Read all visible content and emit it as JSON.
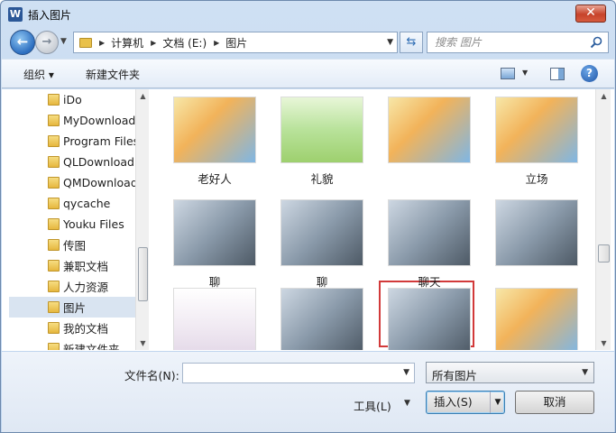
{
  "window": {
    "title": "插入图片",
    "app_icon": "W",
    "close_glyph": "✕"
  },
  "nav": {
    "back_glyph": "←",
    "forward_glyph": "→",
    "breadcrumbs": [
      "计算机",
      "文档 (E:)",
      "图片"
    ],
    "search_placeholder": "搜索 图片"
  },
  "toolbar": {
    "organize_label": "组织 ▾",
    "new_folder_label": "新建文件夹",
    "help_glyph": "?"
  },
  "sidebar": {
    "items": [
      {
        "label": "iDo",
        "selected": false
      },
      {
        "label": "MyDownloads",
        "selected": false
      },
      {
        "label": "Program Files",
        "selected": false
      },
      {
        "label": "QLDownload",
        "selected": false
      },
      {
        "label": "QMDownload",
        "selected": false
      },
      {
        "label": "qycache",
        "selected": false
      },
      {
        "label": "Youku Files",
        "selected": false
      },
      {
        "label": "传图",
        "selected": false
      },
      {
        "label": "兼职文档",
        "selected": false
      },
      {
        "label": "人力资源",
        "selected": false
      },
      {
        "label": "图片",
        "selected": true
      },
      {
        "label": "我的文档",
        "selected": false
      },
      {
        "label": "新建文件夹",
        "selected": false
      }
    ]
  },
  "files": [
    {
      "label": "老好人",
      "icon": "cartoon-image"
    },
    {
      "label": "礼貌",
      "icon": "text-graphic-image"
    },
    {
      "label": "",
      "icon": "cartoon-image"
    },
    {
      "label": "立场",
      "icon": "cartoon-image"
    },
    {
      "label": "聊",
      "icon": "photo-image"
    },
    {
      "label": "聊",
      "icon": "photo-image"
    },
    {
      "label": "聊天",
      "icon": "photo-image"
    },
    {
      "label": "",
      "icon": "photo-image"
    },
    {
      "label": "",
      "icon": "document-image"
    },
    {
      "label": "",
      "icon": "photo-image"
    },
    {
      "label": "",
      "icon": "photo-image",
      "selected": true
    },
    {
      "label": "",
      "icon": "cartoon-image"
    }
  ],
  "bottom": {
    "filename_label": "文件名(N):",
    "filename_value": "",
    "filetype_value": "所有图片",
    "tools_label": "工具(L)",
    "insert_label": "插入(S)",
    "cancel_label": "取消"
  }
}
